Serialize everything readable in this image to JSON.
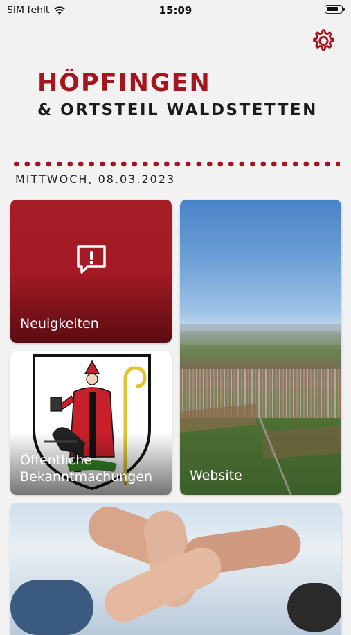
{
  "status_bar": {
    "carrier": "SIM fehlt",
    "time": "15:09"
  },
  "header": {
    "title": "HÖPFINGEN",
    "subtitle": "& ORTSTEIL WALDSTETTEN"
  },
  "date": "MITTWOCH, 08.03.2023",
  "tiles": {
    "news": "Neuigkeiten",
    "announcements": "Öffentliche Bekanntmachungen",
    "website": "Website"
  },
  "colors": {
    "brand_red": "#a4161f",
    "background": "#f2f2f3"
  },
  "icons": {
    "settings": "gear-icon",
    "news": "speech-bubble-exclamation-icon"
  }
}
